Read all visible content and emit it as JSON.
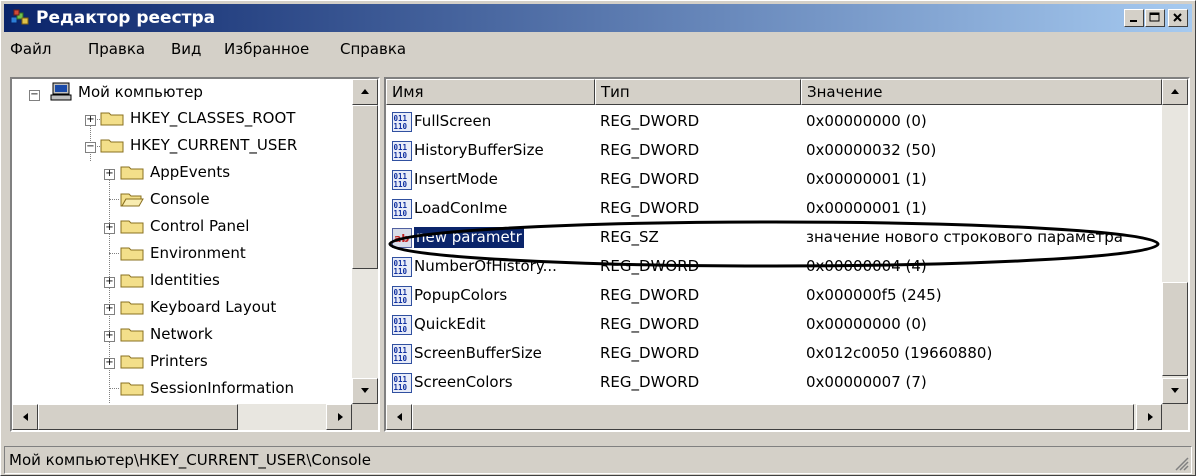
{
  "window": {
    "title": "Редактор реестра",
    "icon": "regedit-icon"
  },
  "menu": [
    "Файл",
    "Правка",
    "Вид",
    "Избранное",
    "Справка"
  ],
  "tree": {
    "root": "Мой компьютер",
    "hives": [
      {
        "label": "HKEY_CLASSES_ROOT",
        "expanded": false
      },
      {
        "label": "HKEY_CURRENT_USER",
        "expanded": true
      }
    ],
    "children": [
      {
        "label": "AppEvents",
        "has_children": true
      },
      {
        "label": "Console",
        "has_children": false,
        "open": true
      },
      {
        "label": "Control Panel",
        "has_children": true
      },
      {
        "label": "Environment",
        "has_children": false
      },
      {
        "label": "Identities",
        "has_children": true
      },
      {
        "label": "Keyboard Layout",
        "has_children": true
      },
      {
        "label": "Network",
        "has_children": true
      },
      {
        "label": "Printers",
        "has_children": true
      },
      {
        "label": "SessionInformation",
        "has_children": false
      }
    ]
  },
  "list": {
    "columns": [
      "Имя",
      "Тип",
      "Значение"
    ],
    "rows": [
      {
        "name": "FullScreen",
        "type": "REG_DWORD",
        "value": "0x00000000 (0)",
        "icon": "dword-icon"
      },
      {
        "name": "HistoryBufferSize",
        "type": "REG_DWORD",
        "value": "0x00000032 (50)",
        "icon": "dword-icon"
      },
      {
        "name": "InsertMode",
        "type": "REG_DWORD",
        "value": "0x00000001 (1)",
        "icon": "dword-icon"
      },
      {
        "name": "LoadConIme",
        "type": "REG_DWORD",
        "value": "0x00000001 (1)",
        "icon": "dword-icon"
      },
      {
        "name": "new parametr",
        "type": "REG_SZ",
        "value": "значение нового строкового параметра",
        "icon": "string-icon",
        "selected": true
      },
      {
        "name": "NumberOfHistory...",
        "type": "REG_DWORD",
        "value": "0x00000004 (4)",
        "icon": "dword-icon"
      },
      {
        "name": "PopupColors",
        "type": "REG_DWORD",
        "value": "0x000000f5 (245)",
        "icon": "dword-icon"
      },
      {
        "name": "QuickEdit",
        "type": "REG_DWORD",
        "value": "0x00000000 (0)",
        "icon": "dword-icon"
      },
      {
        "name": "ScreenBufferSize",
        "type": "REG_DWORD",
        "value": "0x012c0050 (19660880)",
        "icon": "dword-icon"
      },
      {
        "name": "ScreenColors",
        "type": "REG_DWORD",
        "value": "0x00000007 (7)",
        "icon": "dword-icon"
      }
    ]
  },
  "status": "Мой компьютер\\HKEY_CURRENT_USER\\Console",
  "colors": {
    "title_start": "#0a246a",
    "title_end": "#a6caf0",
    "selection": "#0a246a",
    "face": "#d4d0c8"
  }
}
